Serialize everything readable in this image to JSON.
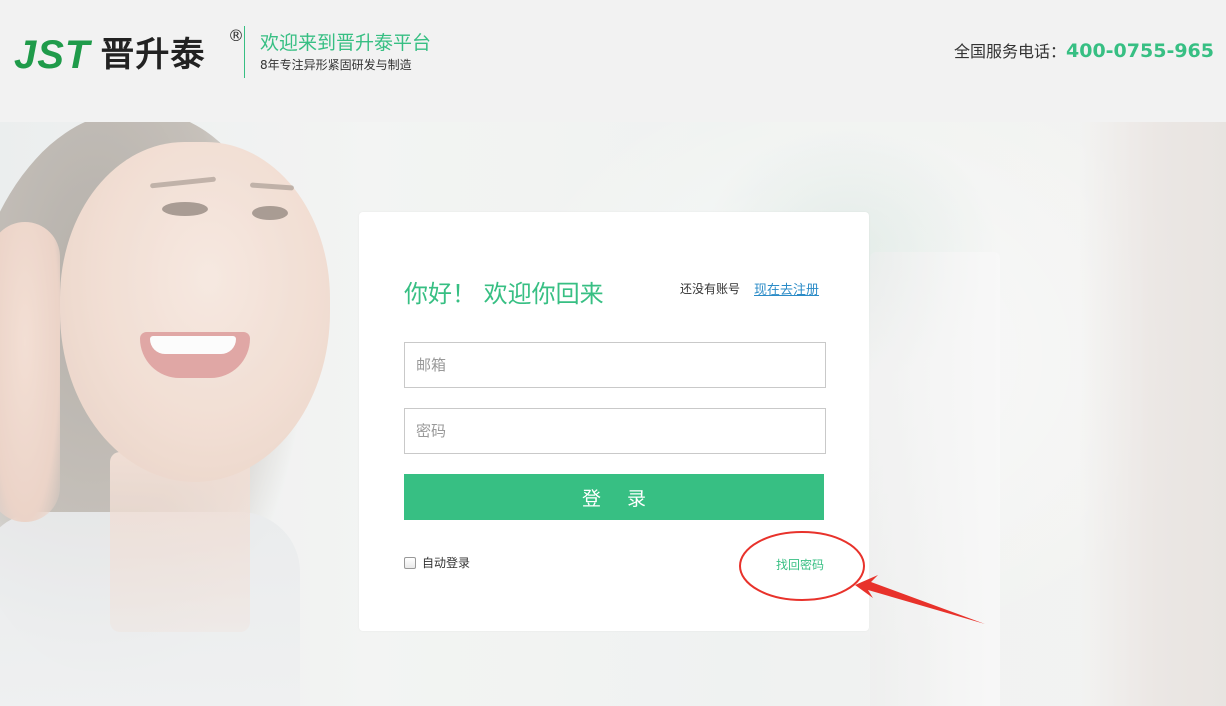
{
  "header": {
    "logo_latin": "JST",
    "logo_chinese": "晋升泰",
    "registered_mark": "®",
    "slogan": "欢迎来到晋升泰平台",
    "subslogan": "8年专注异形紧固研发与制造",
    "phone_label": "全国服务电话：",
    "phone_number": "400-0755-965"
  },
  "login": {
    "title": "你好！ 欢迎你回来",
    "no_account_text": "还没有账号",
    "register_link": "现在去注册",
    "email_placeholder": "邮箱",
    "password_placeholder": "密码",
    "login_button": "登 录",
    "auto_login_label": "自动登录",
    "auto_login_checked": false,
    "forgot_password": "找回密码"
  },
  "colors": {
    "brand_green": "#37bf83",
    "link_blue": "#2a8bc7",
    "annotation_red": "#e8322b"
  }
}
